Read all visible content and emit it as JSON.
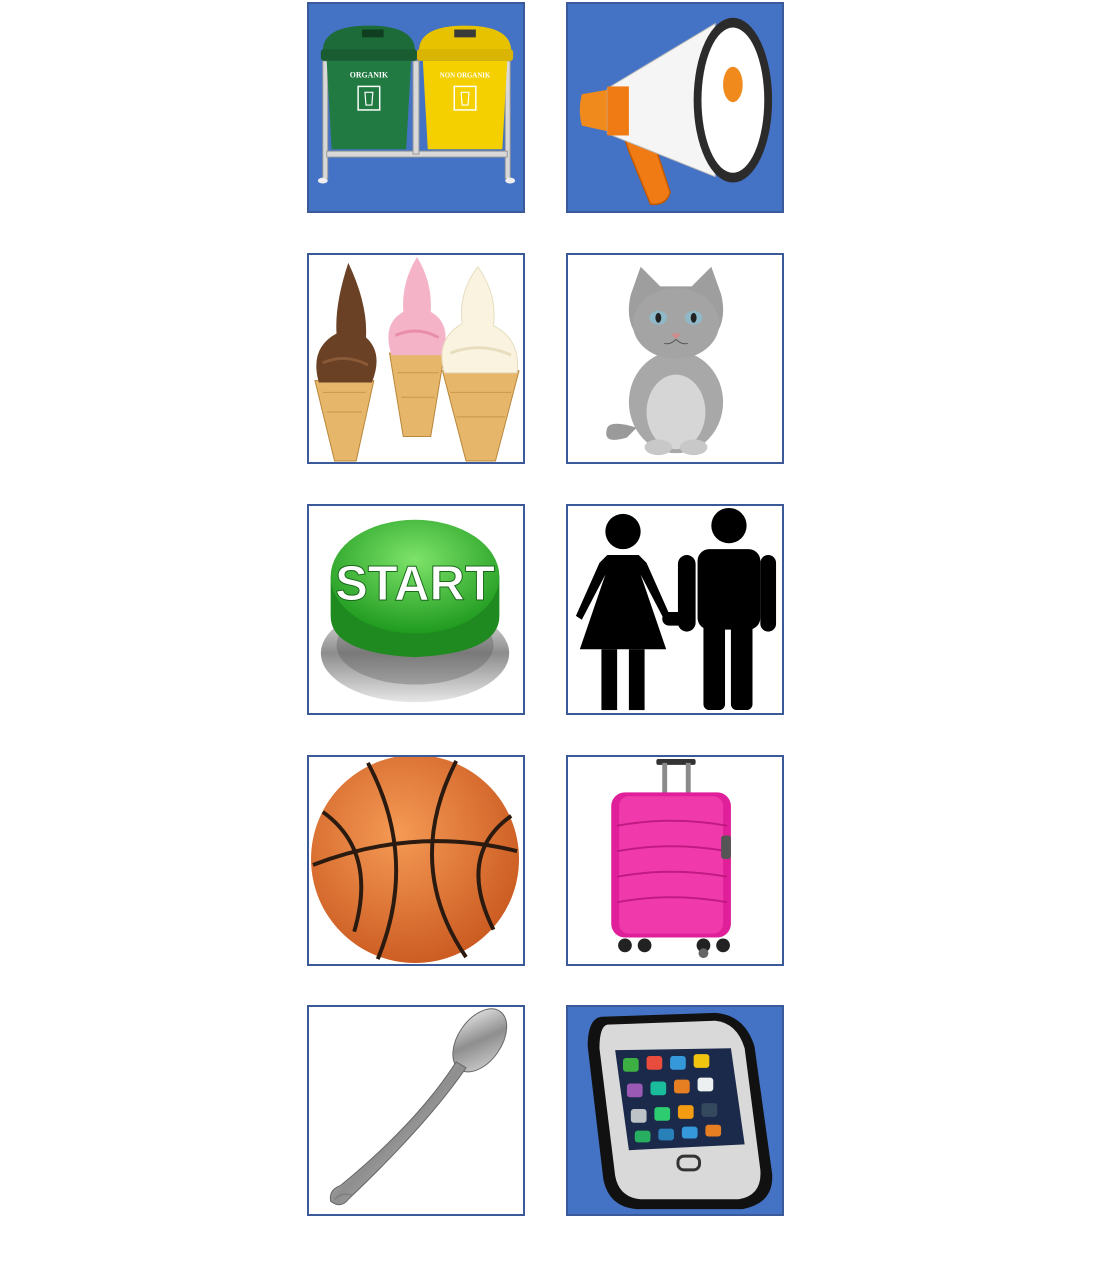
{
  "colors": {
    "tile_blue": "#4472c4",
    "tile_border": "#3a5a9a",
    "tile_white": "#ffffff"
  },
  "tiles": [
    {
      "icon": "trash-bins-icon",
      "bin_left_label": "ORGANIK",
      "bin_right_label": "NON ORGANIK",
      "background": "blue"
    },
    {
      "icon": "megaphone-icon",
      "background": "blue"
    },
    {
      "icon": "ice-cream-icon",
      "background": "white"
    },
    {
      "icon": "kitten-icon",
      "background": "white"
    },
    {
      "icon": "start-button-icon",
      "button_label": "START",
      "background": "white"
    },
    {
      "icon": "couple-icon",
      "background": "white"
    },
    {
      "icon": "basketball-icon",
      "background": "white"
    },
    {
      "icon": "suitcase-icon",
      "background": "white"
    },
    {
      "icon": "spoon-icon",
      "background": "white"
    },
    {
      "icon": "smartphone-icon",
      "background": "blue"
    }
  ]
}
